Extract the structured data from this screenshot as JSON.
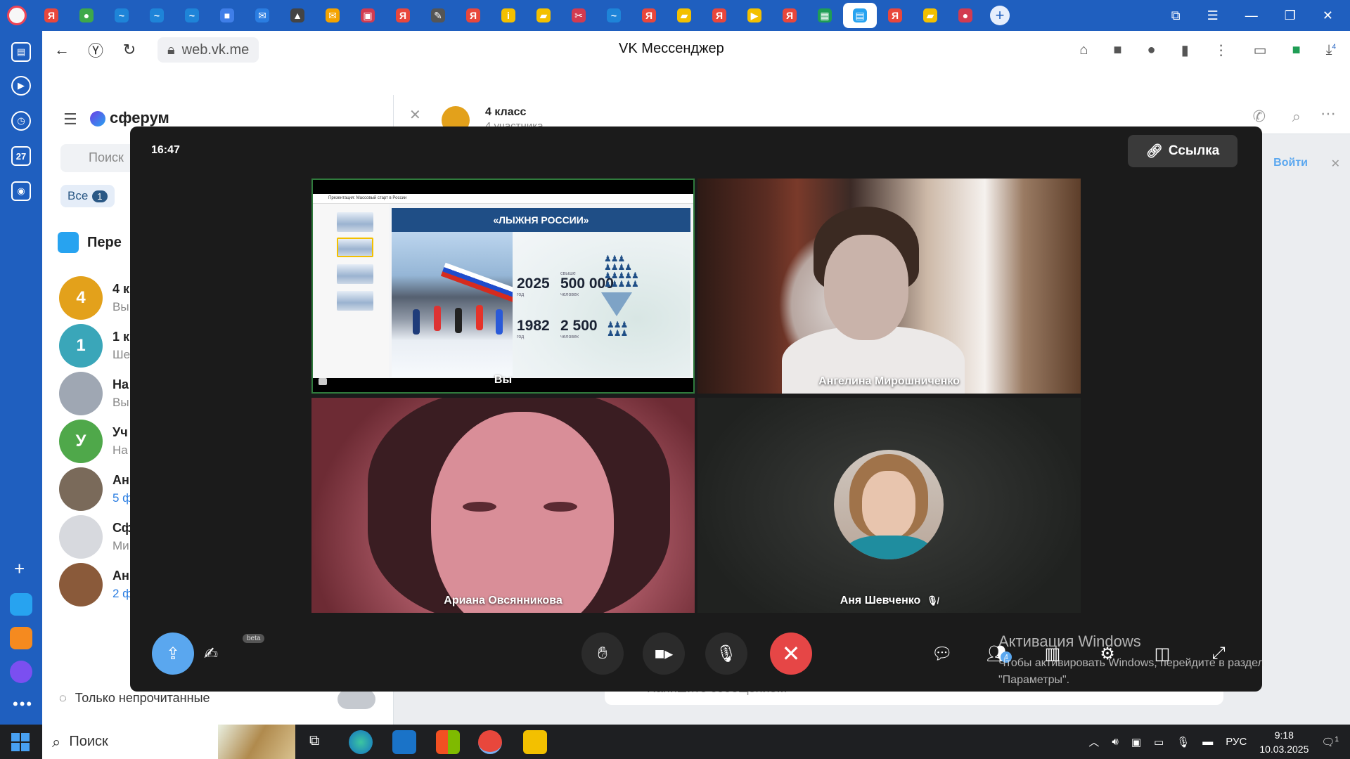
{
  "browser": {
    "tabs": [
      {
        "icon": "yandex-icon",
        "color": "#e8473c",
        "glyph": "Я"
      },
      {
        "icon": "shield-icon",
        "color": "#3ea84a",
        "glyph": "●"
      },
      {
        "icon": "edge-icon",
        "color": "#1e84d8",
        "glyph": "~"
      },
      {
        "icon": "edge-icon",
        "color": "#1e84d8",
        "glyph": "~"
      },
      {
        "icon": "edge-icon",
        "color": "#1e84d8",
        "glyph": "~"
      },
      {
        "icon": "cube-icon",
        "color": "#3f7ee8",
        "glyph": "■"
      },
      {
        "icon": "mail-icon",
        "color": "#2a7de1",
        "glyph": "✉"
      },
      {
        "icon": "hat-icon",
        "color": "#444",
        "glyph": "▲"
      },
      {
        "icon": "gmail-icon",
        "color": "#f4a300",
        "glyph": "✉"
      },
      {
        "icon": "picture-icon",
        "color": "#d23b50",
        "glyph": "▣"
      },
      {
        "icon": "yandex-icon",
        "color": "#e8473c",
        "glyph": "Я"
      },
      {
        "icon": "doc-icon",
        "color": "#555",
        "glyph": "✎"
      },
      {
        "icon": "yandex-icon",
        "color": "#e8473c",
        "glyph": "Я"
      },
      {
        "icon": "info-icon",
        "color": "#f3c000",
        "glyph": "i"
      },
      {
        "icon": "folder-icon",
        "color": "#f3c000",
        "glyph": "▰"
      },
      {
        "icon": "scissors-icon",
        "color": "#d23b50",
        "glyph": "✂"
      },
      {
        "icon": "edge-icon",
        "color": "#1e84d8",
        "glyph": "~"
      },
      {
        "icon": "yandex-icon",
        "color": "#e8473c",
        "glyph": "Я"
      },
      {
        "icon": "folder-icon",
        "color": "#f3c000",
        "glyph": "▰"
      },
      {
        "icon": "yandex-icon",
        "color": "#e8473c",
        "glyph": "Я"
      },
      {
        "icon": "play-icon",
        "color": "#f3c000",
        "glyph": "▶"
      },
      {
        "icon": "yandex-icon",
        "color": "#e8473c",
        "glyph": "Я"
      },
      {
        "icon": "spreadsheet-icon",
        "color": "#1f9d55",
        "glyph": "▦"
      },
      {
        "icon": "sferum-icon",
        "color": "#27a3f0",
        "glyph": "▤",
        "active": true
      },
      {
        "icon": "yandex-icon",
        "color": "#e8473c",
        "glyph": "Я"
      },
      {
        "icon": "folder-icon",
        "color": "#f3c000",
        "glyph": "▰"
      },
      {
        "icon": "record-icon",
        "color": "#d23b50",
        "glyph": "●"
      }
    ],
    "url": "web.vk.me",
    "page_title": "VK Мессенджер",
    "downloads_count": "4",
    "sidebar_day": "27"
  },
  "vk": {
    "logo": "сферум",
    "search_placeholder": "Поиск",
    "filter_all": "Все",
    "filter_count": "1",
    "pinned": "Пере",
    "chats": [
      {
        "name": "4 к",
        "sub": "Вы",
        "color": "#e3a11b",
        "initial": "4"
      },
      {
        "name": "1 к",
        "sub": "Ше",
        "color": "#3aa6b9",
        "initial": "1"
      },
      {
        "name": "На",
        "sub": "Вы",
        "color": "#9fa7b3",
        "initial": ""
      },
      {
        "name": "Уч",
        "sub": "На",
        "color": "#4fa84a",
        "initial": "У"
      },
      {
        "name": "Ан",
        "sub": "5 ф",
        "color": "#7a6a5a",
        "initial": ""
      },
      {
        "name": "Сф",
        "sub": "Ми",
        "color": "#d7d9de",
        "initial": ""
      },
      {
        "name": "Ан",
        "sub": "2 ф",
        "color": "#8a5a3a",
        "initial": ""
      }
    ],
    "unread_only": "Только непрочитанные",
    "chat_title": "4 класс",
    "chat_sub": "4 участника",
    "message_placeholder": "Напишите сообщение...",
    "join_label": "Войти"
  },
  "call": {
    "time": "16:47",
    "link_label": "Ссылка",
    "slide": {
      "file": "Презентация: Массовый старт в России",
      "title": "«ЛЫЖНЯ РОССИИ»",
      "year_new": "2025",
      "year_old": "1982",
      "count_new": "500 000",
      "count_old": "2 500",
      "above_label": "свыше",
      "year_caption": "год",
      "people_caption": "человек"
    },
    "tiles": {
      "self": "Вы",
      "p2": "Ангелина Мирошниченко",
      "p3": "Ариана Овсянникова",
      "p4": "Аня Шевченко"
    },
    "beta_label": "beta",
    "participants_count": "4"
  },
  "activation": {
    "heading": "Активация Windows",
    "text": "Чтобы активировать Windows, перейдите в раздел \"Параметры\"."
  },
  "taskbar": {
    "search": "Поиск",
    "lang": "РУС",
    "time": "9:18",
    "date": "10.03.2025",
    "notifications": "1"
  }
}
